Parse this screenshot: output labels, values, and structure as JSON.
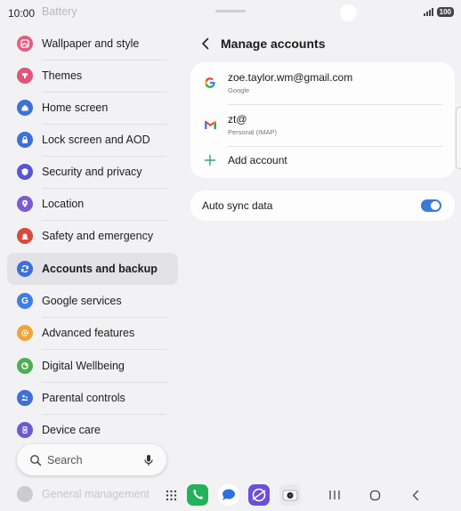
{
  "status_bar": {
    "time": "10:00",
    "battery": "100"
  },
  "settings_list": {
    "faded_top": "Battery",
    "items": [
      {
        "label": "Wallpaper and style",
        "icon": "wallpaper-icon",
        "color": "#e35d83"
      },
      {
        "label": "Themes",
        "icon": "themes-icon",
        "color": "#e0557b"
      },
      {
        "label": "Home screen",
        "icon": "home-icon",
        "color": "#3f6fd9"
      },
      {
        "label": "Lock screen and AOD",
        "icon": "lock-icon",
        "color": "#3f6fd9"
      },
      {
        "label": "Security and privacy",
        "icon": "shield-icon",
        "color": "#5a55d4"
      },
      {
        "label": "Location",
        "icon": "location-icon",
        "color": "#7a5bd4"
      },
      {
        "label": "Safety and emergency",
        "icon": "emergency-icon",
        "color": "#d84a3f"
      },
      {
        "label": "Accounts and backup",
        "icon": "sync-icon",
        "color": "#3f6fd9"
      },
      {
        "label": "Google services",
        "icon": "google-icon",
        "color": "#3f7ee8"
      },
      {
        "label": "Advanced features",
        "icon": "star-gear-icon",
        "color": "#f0a53a"
      },
      {
        "label": "Digital Wellbeing",
        "icon": "wellbeing-icon",
        "color": "#4caf50"
      },
      {
        "label": "Parental controls",
        "icon": "parental-icon",
        "color": "#3f6fd9"
      },
      {
        "label": "Device care",
        "icon": "device-care-icon",
        "color": "#6a5bd0"
      }
    ],
    "faded_bottom": "General management"
  },
  "search": {
    "placeholder": "Search"
  },
  "manage_accounts": {
    "title": "Manage accounts",
    "accounts": [
      {
        "name": "zoe.taylor.wm@gmail.com",
        "type": "Google",
        "icon": "google-logo-icon"
      },
      {
        "name": "zt@",
        "type": "Personal (IMAP)",
        "icon": "gmail-logo-icon"
      }
    ],
    "add_account": "Add account",
    "auto_sync": {
      "label": "Auto sync data",
      "enabled": true,
      "accent": "#3a7bd5"
    }
  }
}
